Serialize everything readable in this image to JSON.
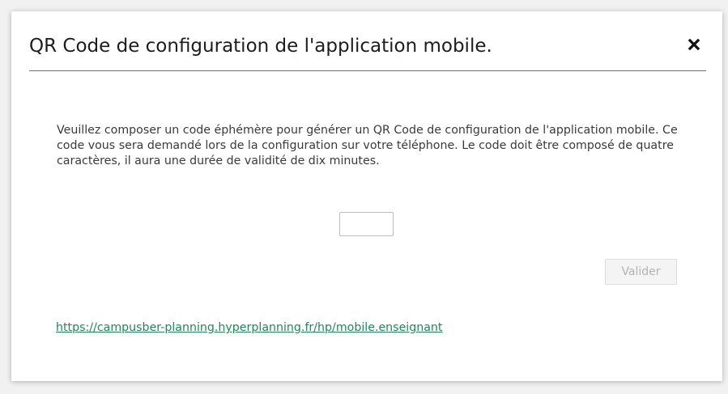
{
  "dialog": {
    "title": "QR Code de configuration de l'application mobile.",
    "close_icon": "close-icon",
    "description": "Veuillez composer un code éphémère pour générer un QR Code de configuration de l'application mobile. Ce code vous sera demandé lors de la configuration sur votre téléphone. Le code doit être composé de quatre caractères, il aura une durée de validité de dix minutes.",
    "code_input": {
      "value": "",
      "placeholder": ""
    },
    "validate_label": "Valider",
    "link": "https://campusber-planning.hyperplanning.fr/hp/mobile.enseignant"
  },
  "colors": {
    "accent": "#2f8f5f",
    "link": "#1e8a55",
    "disabled_text": "#b3b3b3"
  }
}
